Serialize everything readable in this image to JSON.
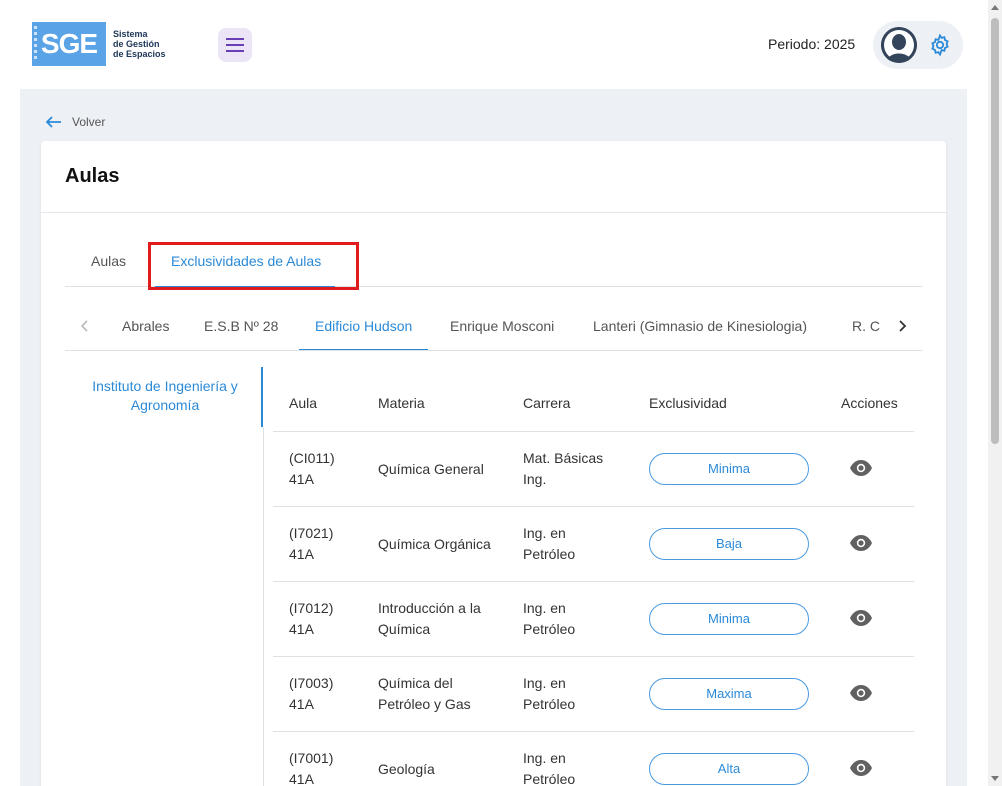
{
  "header": {
    "logo_mark": "SGE",
    "logo_lines": [
      "Sistema",
      "de Gestión",
      "de Espacios"
    ],
    "periodo": "Periodo: 2025"
  },
  "nav": {
    "back_label": "Volver"
  },
  "page": {
    "title": "Aulas"
  },
  "main_tabs": [
    {
      "label": "Aulas",
      "active": false
    },
    {
      "label": "Exclusividades de Aulas",
      "active": true
    }
  ],
  "building_tabs": [
    {
      "label": "Abrales"
    },
    {
      "label": "E.S.B Nº 28"
    },
    {
      "label": "Edificio Hudson",
      "active": true
    },
    {
      "label": "Enrique Mosconi"
    },
    {
      "label": "Lanteri (Gimnasio de Kinesiologia)"
    },
    {
      "label": "R. C"
    }
  ],
  "side_nav": {
    "items": [
      {
        "label": "Instituto de Ingeniería y Agronomía"
      }
    ]
  },
  "table": {
    "headers": {
      "aula": "Aula",
      "materia": "Materia",
      "carrera": "Carrera",
      "exclusividad": "Exclusividad",
      "acciones": "Acciones"
    },
    "rows": [
      {
        "aula": [
          "(CI011)",
          "41A"
        ],
        "materia": [
          "Química General"
        ],
        "carrera": [
          "Mat. Básicas",
          "Ing."
        ],
        "exclusividad": "Minima"
      },
      {
        "aula": [
          "(I7021)",
          "41A"
        ],
        "materia": [
          "Química Orgánica"
        ],
        "carrera": [
          "Ing. en",
          "Petróleo"
        ],
        "exclusividad": "Baja"
      },
      {
        "aula": [
          "(I7012)",
          "41A"
        ],
        "materia": [
          "Introducción a la",
          "Química"
        ],
        "carrera": [
          "Ing. en",
          "Petróleo"
        ],
        "exclusividad": "Minima"
      },
      {
        "aula": [
          "(I7003)",
          "41A"
        ],
        "materia": [
          "Química del",
          "Petróleo y Gas"
        ],
        "carrera": [
          "Ing. en",
          "Petróleo"
        ],
        "exclusividad": "Maxima"
      },
      {
        "aula": [
          "(I7001)",
          "41A"
        ],
        "materia": [
          "Geología"
        ],
        "carrera": [
          "Ing. en",
          "Petróleo"
        ],
        "exclusividad": "Alta"
      }
    ]
  },
  "colors": {
    "accent": "#2b8ad8",
    "highlight": "#e01b1b",
    "background": "#edf0f4"
  }
}
